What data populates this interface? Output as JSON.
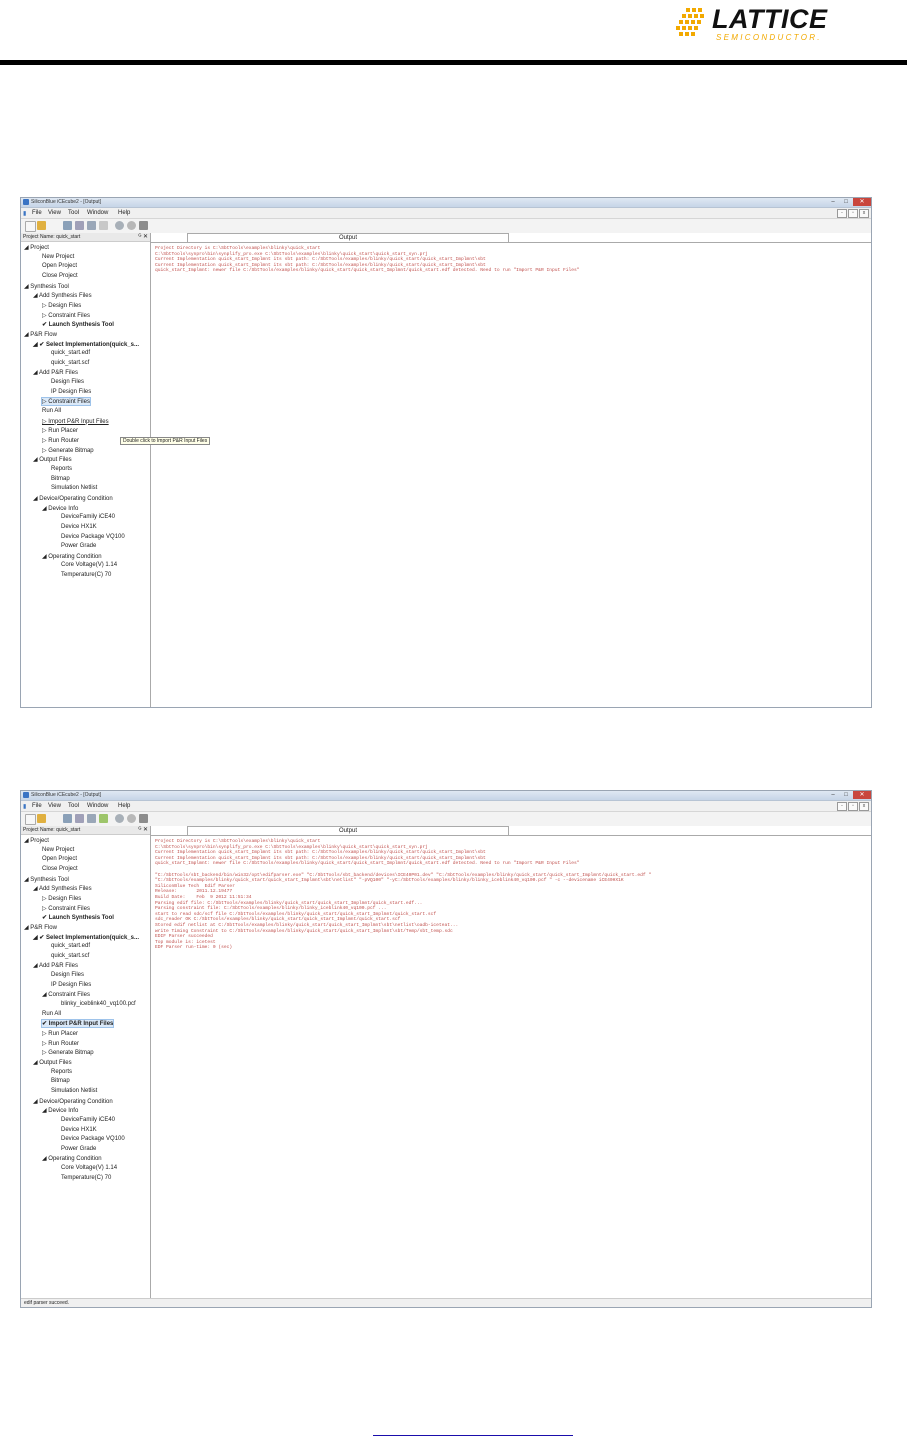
{
  "logo": {
    "name": "LATTICE",
    "sub": "SEMICONDUCTOR."
  },
  "windows": [
    {
      "title": "SiliconBlue iCEcube2 - [Output]",
      "menu": [
        "File",
        "View",
        "Tool",
        "Window",
        "Help"
      ],
      "project_name": "Project Name: quick_start",
      "output_tab": "Output",
      "tooltip": "Double click to Import P&R Input Files",
      "status": "",
      "tree": [
        {
          "t": "◢ Project",
          "x": 3,
          "i": ""
        },
        {
          "t": "New Project",
          "x": 21,
          "i": ""
        },
        {
          "t": "Open Project",
          "x": 21,
          "i": ""
        },
        {
          "t": "Close Project",
          "x": 21,
          "i": ""
        },
        {
          "t": "◢ Synthesis Tool",
          "x": 3,
          "i": ""
        },
        {
          "t": "◢ Add Synthesis Files",
          "x": 12,
          "i": ""
        },
        {
          "t": "▷ Design Files",
          "x": 21,
          "i": ""
        },
        {
          "t": "▷ Constraint Files",
          "x": 21,
          "i": ""
        },
        {
          "t": "✔ Launch Synthesis Tool",
          "x": 21,
          "i": "chk"
        },
        {
          "t": "◢ P&R Flow",
          "x": 3,
          "i": ""
        },
        {
          "t": "◢ ✔ Select Implementation(quick_s...",
          "x": 12,
          "i": "chk"
        },
        {
          "t": "quick_start.edf",
          "x": 30,
          "i": ""
        },
        {
          "t": "quick_start.scf",
          "x": 30,
          "i": ""
        },
        {
          "t": "◢ Add P&R Files",
          "x": 12,
          "i": ""
        },
        {
          "t": "Design Files",
          "x": 30,
          "i": ""
        },
        {
          "t": "IP Design Files",
          "x": 30,
          "i": ""
        },
        {
          "t": "▷ Constraint Files",
          "x": 21,
          "i": "sel"
        },
        {
          "t": "Run All",
          "x": 21,
          "i": ""
        },
        {
          "t": "▷ Import P&R Input Files",
          "x": 21,
          "i": "red"
        },
        {
          "t": "▷ Run Placer",
          "x": 21,
          "i": "dim"
        },
        {
          "t": "▷ Run Router",
          "x": 21,
          "i": "dim"
        },
        {
          "t": "▷ Generate Bitmap",
          "x": 21,
          "i": "dim"
        },
        {
          "t": "◢ Output Files",
          "x": 12,
          "i": ""
        },
        {
          "t": "Reports",
          "x": 30,
          "i": ""
        },
        {
          "t": "Bitmap",
          "x": 30,
          "i": ""
        },
        {
          "t": "Simulation Netlist",
          "x": 30,
          "i": ""
        },
        {
          "t": "◢ Device/Operating Condition",
          "x": 12,
          "i": ""
        },
        {
          "t": "◢ Device Info",
          "x": 21,
          "i": ""
        },
        {
          "t": "DeviceFamily        iCE40",
          "x": 40,
          "i": ""
        },
        {
          "t": "Device                  HX1K",
          "x": 40,
          "i": ""
        },
        {
          "t": "Device Package    VQ100",
          "x": 40,
          "i": ""
        },
        {
          "t": "Power Grade",
          "x": 40,
          "i": ""
        },
        {
          "t": "◢ Operating Condition",
          "x": 21,
          "i": ""
        },
        {
          "t": "Core Voltage(V)    1.14",
          "x": 40,
          "i": ""
        },
        {
          "t": "Temperature(C)     70",
          "x": 40,
          "i": ""
        }
      ],
      "log": [
        "Project Directory is C:\\SbtTools\\examples\\blinky\\quick_start",
        "C:\\SbtTools\\synpro\\bin\\synplify_pro.exe C:\\SbtTools\\examples\\blinky\\quick_start\\quick_start_syn.prj",
        "Current Implementation quick_start_Implmnt its sbt path: C:/SbtTools/examples/blinky/quick_start/quick_start_Implmnt\\sbt",
        "Current Implementation quick_start_Implmnt its sbt path: C:/SbtTools/examples/blinky/quick_start/quick_start_Implmnt\\sbt",
        "quick_start_Implmnt: newer file C:/SbtTools/examples/blinky/quick_start/quick_start_Implmnt/quick_start.edf detected. Need to run \"Import P&R Input Files\""
      ]
    },
    {
      "title": "SiliconBlue iCEcube2 - [Output]",
      "menu": [
        "File",
        "View",
        "Tool",
        "Window",
        "Help"
      ],
      "project_name": "Project Name: quick_start",
      "output_tab": "Output",
      "tooltip": "",
      "status": "edif parser succeed.",
      "tree": [
        {
          "t": "◢ Project",
          "x": 3,
          "i": ""
        },
        {
          "t": "New Project",
          "x": 21,
          "i": ""
        },
        {
          "t": "Open Project",
          "x": 21,
          "i": ""
        },
        {
          "t": "Close Project",
          "x": 21,
          "i": ""
        },
        {
          "t": "◢ Synthesis Tool",
          "x": 3,
          "i": ""
        },
        {
          "t": "◢ Add Synthesis Files",
          "x": 12,
          "i": ""
        },
        {
          "t": "▷ Design Files",
          "x": 21,
          "i": ""
        },
        {
          "t": "▷ Constraint Files",
          "x": 21,
          "i": ""
        },
        {
          "t": "✔ Launch Synthesis Tool",
          "x": 21,
          "i": "chk"
        },
        {
          "t": "◢ P&R Flow",
          "x": 3,
          "i": ""
        },
        {
          "t": "◢ ✔ Select Implementation(quick_s...",
          "x": 12,
          "i": "chk"
        },
        {
          "t": "quick_start.edf",
          "x": 30,
          "i": ""
        },
        {
          "t": "quick_start.scf",
          "x": 30,
          "i": ""
        },
        {
          "t": "◢ Add P&R Files",
          "x": 12,
          "i": ""
        },
        {
          "t": "Design Files",
          "x": 30,
          "i": ""
        },
        {
          "t": "IP Design Files",
          "x": 30,
          "i": ""
        },
        {
          "t": "◢ Constraint Files",
          "x": 21,
          "i": ""
        },
        {
          "t": "blinky_iceblink40_vq100.pcf",
          "x": 40,
          "i": ""
        },
        {
          "t": "Run All",
          "x": 21,
          "i": ""
        },
        {
          "t": "✔ Import P&R Input Files",
          "x": 21,
          "i": "chk sel"
        },
        {
          "t": "▷ Run Placer",
          "x": 21,
          "i": "play"
        },
        {
          "t": "▷ Run Router",
          "x": 21,
          "i": "dim"
        },
        {
          "t": "▷ Generate Bitmap",
          "x": 21,
          "i": "dim"
        },
        {
          "t": "◢ Output Files",
          "x": 12,
          "i": ""
        },
        {
          "t": "Reports",
          "x": 30,
          "i": ""
        },
        {
          "t": "Bitmap",
          "x": 30,
          "i": ""
        },
        {
          "t": "Simulation Netlist",
          "x": 30,
          "i": ""
        },
        {
          "t": "◢ Device/Operating Condition",
          "x": 12,
          "i": ""
        },
        {
          "t": "◢ Device Info",
          "x": 21,
          "i": ""
        },
        {
          "t": "DeviceFamily        iCE40",
          "x": 40,
          "i": ""
        },
        {
          "t": "Device                  HX1K",
          "x": 40,
          "i": ""
        },
        {
          "t": "Device Package    VQ100",
          "x": 40,
          "i": ""
        },
        {
          "t": "Power Grade",
          "x": 40,
          "i": ""
        },
        {
          "t": "◢ Operating Condition",
          "x": 21,
          "i": ""
        },
        {
          "t": "Core Voltage(V)    1.14",
          "x": 40,
          "i": ""
        },
        {
          "t": "Temperature(C)     70",
          "x": 40,
          "i": ""
        }
      ],
      "log": [
        "Project Directory is C:\\SbtTools\\examples\\blinky\\quick_start",
        "C:\\SbtTools\\synpro\\bin\\synplify_pro.exe C:\\SbtTools\\examples\\blinky\\quick_start\\quick_start_syn.prj",
        "Current Implementation quick_start_Implmnt its sbt path: C:/SbtTools/examples/blinky/quick_start/quick_start_Implmnt\\sbt",
        "Current Implementation quick_start_Implmnt its sbt path: C:/SbtTools/examples/blinky/quick_start/quick_start_Implmnt\\sbt",
        "quick_start_Implmnt: newer file C:/SbtTools/examples/blinky/quick_start/quick_start_Implmnt/quick_start.edf detected. Need to run \"Import P&R Input Files\"",
        "",
        "\"C:/SbtTools/sbt_backend/bin/win32/opt\\edifparser.exe\" \"C:/SbtTools/sbt_backend/devices\\ICE40P01.dev\" \"C:/SbtTools/examples/blinky/quick_start/quick_start_Implmnt/quick_start.edf \"",
        "\"C:/SbtTools/examples/blinky/quick_start/quick_start_Implmnt\\sbt\\netlist\" \"-pVQ100\" \"-yC:/SbtTools/examples/blinky/blinky_iceblink40_vq100.pcf \" -c --devicename iCE40HX1K",
        "SiliconBlue Tech  Edif Parser",
        "Release:       2011.12.19477",
        "Build Date:    Feb  9 2012 11:51:34",
        "Parsing edif file: C:/SbtTools/examples/blinky/quick_start/quick_start_Implmnt/quick_start.edf...",
        "Parsing constraint file: C:/SbtTools/examples/blinky/blinky_iceblink40_vq100.pcf ...",
        "start to read sdc/scf file C:/SbtTools/examples/blinky/quick_start/quick_start_Implmnt/quick_start.scf",
        "sdc_reader OK C:/SbtTools/examples/blinky/quick_start/quick_start_Implmnt/quick_start.scf",
        "Stored edif netlist at C:/SbtTools/examples/blinky/quick_start/quick_start_Implmnt\\sbt\\netlist\\oadb-iceteat...",
        "write Timing Constraint to C:/SbtTools/examples/blinky/quick_start/quick_start_Implmnt\\sbt/Temp/sbt_temp.sdc",
        "EDIF Parser succeeded",
        "Top module is: icetest",
        "EDF Parser run-time: 0 (sec)"
      ]
    }
  ],
  "footer_link": ""
}
